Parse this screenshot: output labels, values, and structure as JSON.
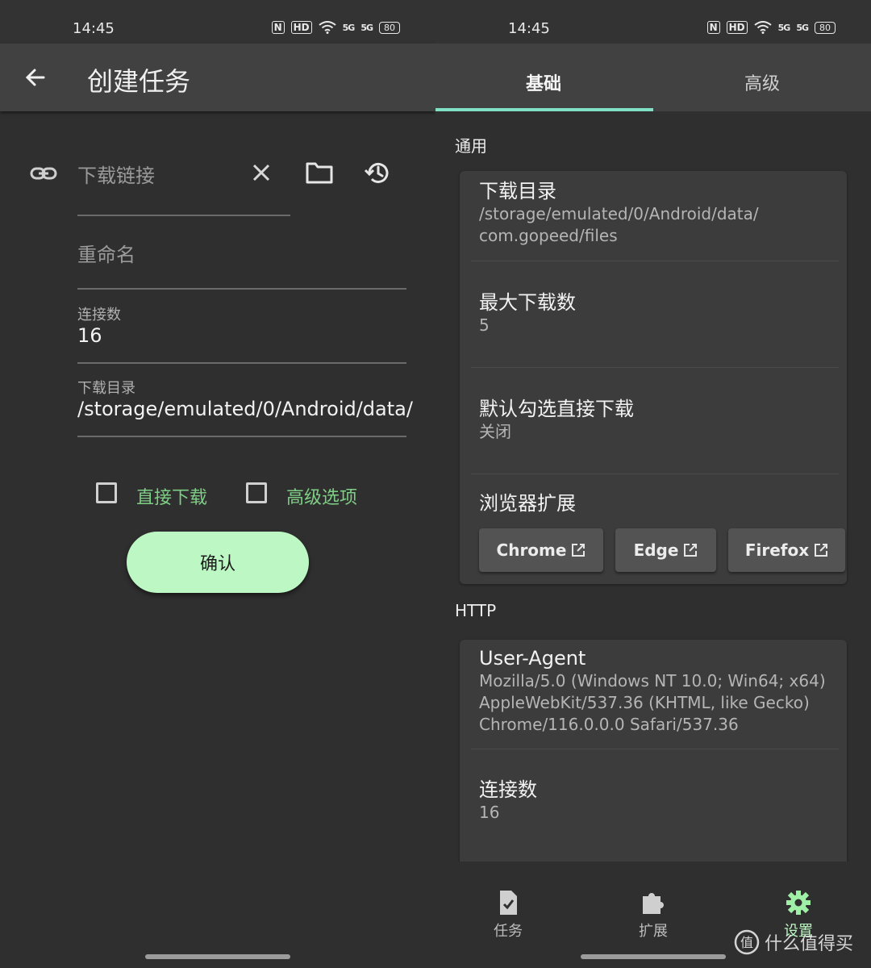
{
  "status_bar": {
    "time": "14:45",
    "nfc": "N",
    "hd": "HD",
    "signal1": "5G",
    "signal2": "5G",
    "battery": "80"
  },
  "left": {
    "appbar_title": "创建任务",
    "url_placeholder": "下载链接",
    "rename_placeholder": "重命名",
    "connections_label": "连接数",
    "connections_value": "16",
    "dir_label": "下载目录",
    "dir_value": "/storage/emulated/0/Android/data/",
    "direct_download_label": "直接下载",
    "advanced_label": "高级选项",
    "confirm_label": "确认"
  },
  "right": {
    "tabs": [
      {
        "label": "基础"
      },
      {
        "label": "高级"
      }
    ],
    "general_title": "通用",
    "general_items": [
      {
        "title": "下载目录",
        "sub1": "/storage/emulated/0/Android/data/",
        "sub2": "com.gopeed/files"
      },
      {
        "title": "最大下载数",
        "sub1": "5"
      },
      {
        "title": "默认勾选直接下载",
        "sub1": "关闭"
      },
      {
        "title": "浏览器扩展"
      }
    ],
    "browser_buttons": [
      {
        "label": "Chrome"
      },
      {
        "label": "Edge"
      },
      {
        "label": "Firefox"
      }
    ],
    "http_title": "HTTP",
    "http_items": [
      {
        "title": "User-Agent",
        "sub1": "Mozilla/5.0 (Windows NT 10.0; Win64; x64)",
        "sub2": "AppleWebKit/537.36 (KHTML, like Gecko)",
        "sub3": "Chrome/116.0.0.0 Safari/537.36"
      },
      {
        "title": "连接数",
        "sub1": "16"
      }
    ],
    "nav": [
      {
        "label": "任务"
      },
      {
        "label": "扩展"
      },
      {
        "label": "设置"
      }
    ]
  },
  "watermark": "什么值得买",
  "colors": {
    "accent_green": "#bdf7c3",
    "checkbox_label_green": "#7fce86",
    "tab_indicator": "#7fe0c4",
    "surface": "#2f2f2f",
    "card": "#3c3c3c"
  }
}
